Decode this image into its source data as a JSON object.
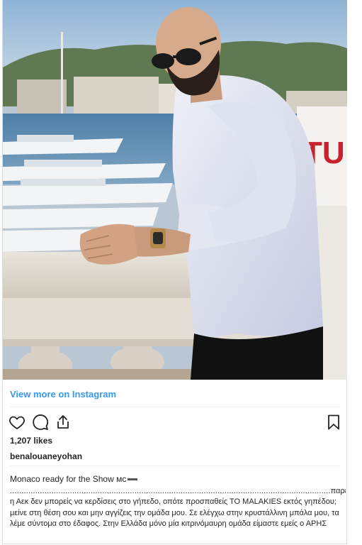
{
  "post": {
    "view_more_label": "View more on Instagram",
    "likes": "1,207 likes",
    "username": "benalouaneyohan",
    "caption_first": "Monaco ready for the Show мс",
    "caption_dots": "...........................................................................................................................................",
    "caption_tail": "παρεμπι",
    "caption_body": "η Αεκ δεν μπορείς να κερδίσεις στο γήπεδο, οπότε προσπαθείς ΤΟ MALAKIES εκτός γηπέδου; μείνε στη θέση σου και μην αγγίζεις την ομάδα μου. Σε ελέγχω στην κρυστάλλινη μπάλα μου, τα λέμε σύντομα στο έδαφος. Στην Ελλάδα μόνο μία κιτρινόμαυρη ομάδα είμαστε εμείς ο ΑΡΗΣ"
  },
  "icons": {
    "like": "heart-icon",
    "comment": "comment-icon",
    "share": "share-icon",
    "save": "bookmark-icon"
  },
  "colors": {
    "link": "#3897f0",
    "text": "#262626",
    "border": "#dbdbdb"
  }
}
